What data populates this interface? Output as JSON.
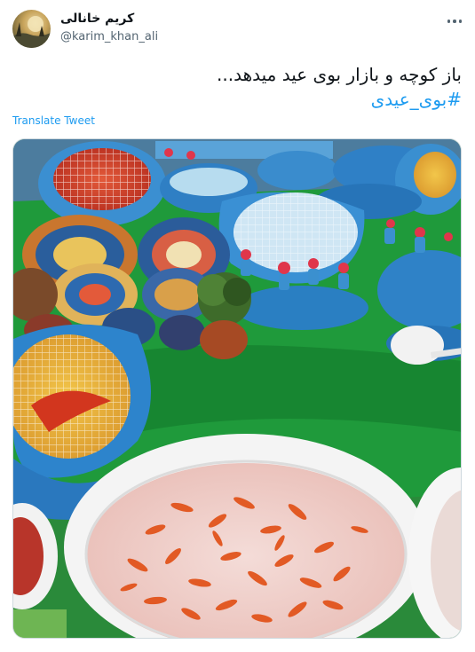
{
  "tweet": {
    "author_name": "کریم خانالی",
    "author_handle": "@karim_khan_ali",
    "text": "باز کوچه و بازار بوی عید میدهد...",
    "hashtag": "#بوی_عیدی",
    "translate_label": "Translate Tweet"
  },
  "icons": {
    "more": "more-options-icon",
    "avatar": "profile-avatar"
  },
  "colors": {
    "link": "#1d9bf0",
    "text": "#0f1419",
    "secondary": "#536471"
  }
}
